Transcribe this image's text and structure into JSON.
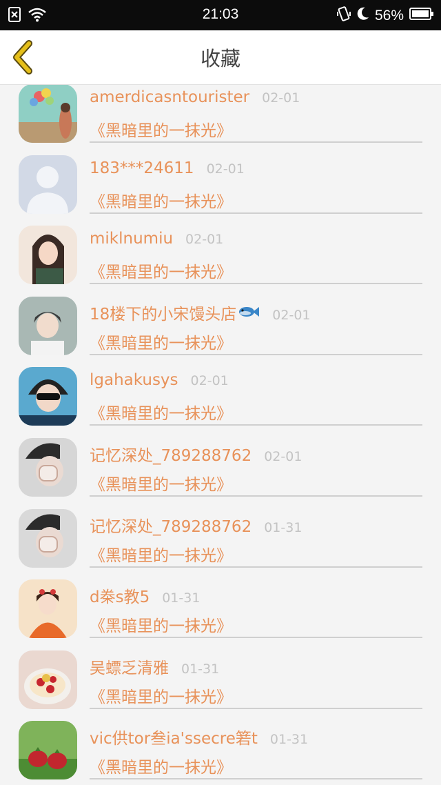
{
  "status_bar": {
    "time": "21:03",
    "battery": "56%",
    "icons": [
      "sim-blocked-icon",
      "wifi-icon",
      "vibrate-icon",
      "moon-icon",
      "battery-icon"
    ]
  },
  "nav": {
    "title": "收藏",
    "back_icon": "chevron-left-icon",
    "accent_color": "#e5bf1a"
  },
  "colors": {
    "name": "#e8925a",
    "date": "#c3c3c3",
    "background": "#f4f4f4"
  },
  "items": [
    {
      "name": "amerdicasntourister",
      "date": "02-01",
      "book": "《黑暗里的一抹光》"
    },
    {
      "name": "183***24611",
      "date": "02-01",
      "book": "《黑暗里的一抹光》"
    },
    {
      "name": "miklnumiu",
      "date": "02-01",
      "book": "《黑暗里的一抹光》"
    },
    {
      "name": "18楼下的小宋馒头店",
      "name_emoji": "fish-icon",
      "date": "02-01",
      "book": "《黑暗里的一抹光》"
    },
    {
      "name": "lgahakusys",
      "date": "02-01",
      "book": "《黑暗里的一抹光》"
    },
    {
      "name": "记忆深处_789288762",
      "date": "02-01",
      "book": "《黑暗里的一抹光》"
    },
    {
      "name": "记忆深处_789288762",
      "date": "01-31",
      "book": "《黑暗里的一抹光》"
    },
    {
      "name": "d桊s教5",
      "date": "01-31",
      "book": "《黑暗里的一抹光》"
    },
    {
      "name": "吴螵乏清雅",
      "date": "01-31",
      "book": "《黑暗里的一抹光》"
    },
    {
      "name": "vic供tor叁ia'ssecre箬t",
      "date": "01-31",
      "book": "《黑暗里的一抹光》"
    }
  ]
}
